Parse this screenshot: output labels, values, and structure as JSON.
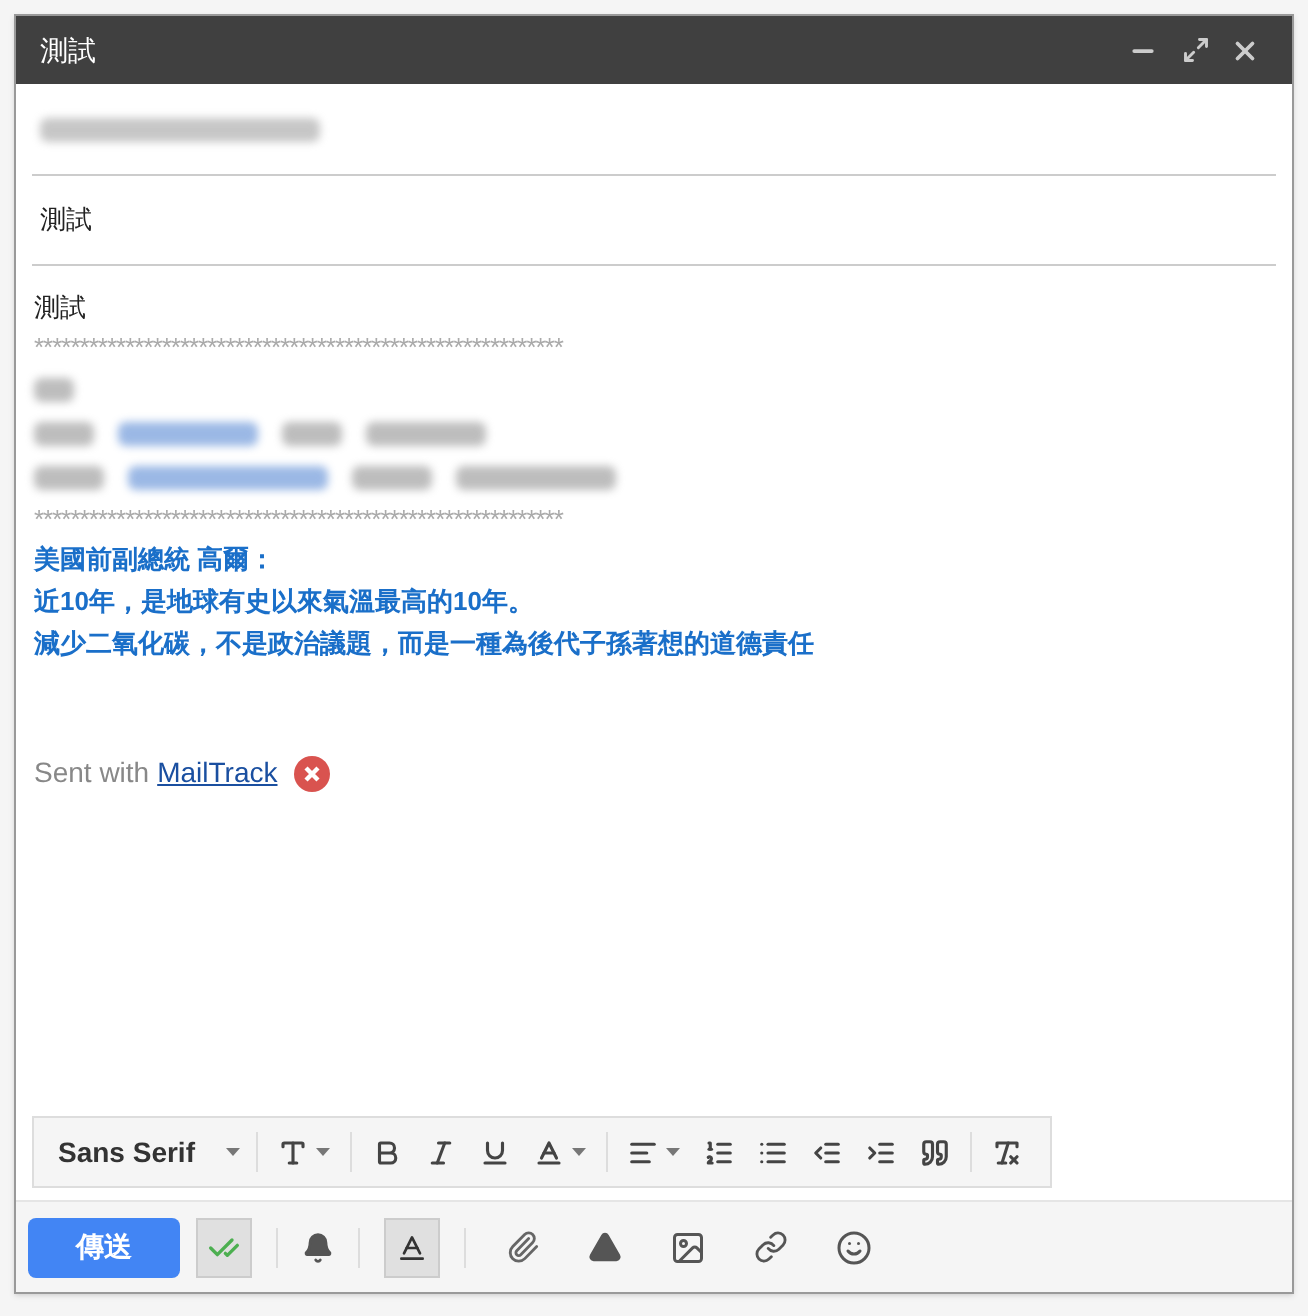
{
  "window": {
    "title": "測試"
  },
  "subject": "測試",
  "body": {
    "greeting": "測試",
    "separator_top": "**********************************************************",
    "separator_bottom": "**********************************************************",
    "quote": [
      "美國前副總統 高爾：",
      "近10年，是地球有史以來氣溫最高的10年。",
      "減少二氧化碳，不是政治議題，而是一種為後代子孫著想的道德責任"
    ],
    "signature": {
      "prefix": "Sent with",
      "link": "MailTrack"
    }
  },
  "format_toolbar": {
    "font": "Sans Serif"
  },
  "bottom_bar": {
    "send": "傳送",
    "tracking_on": true,
    "formatting_on": true
  }
}
